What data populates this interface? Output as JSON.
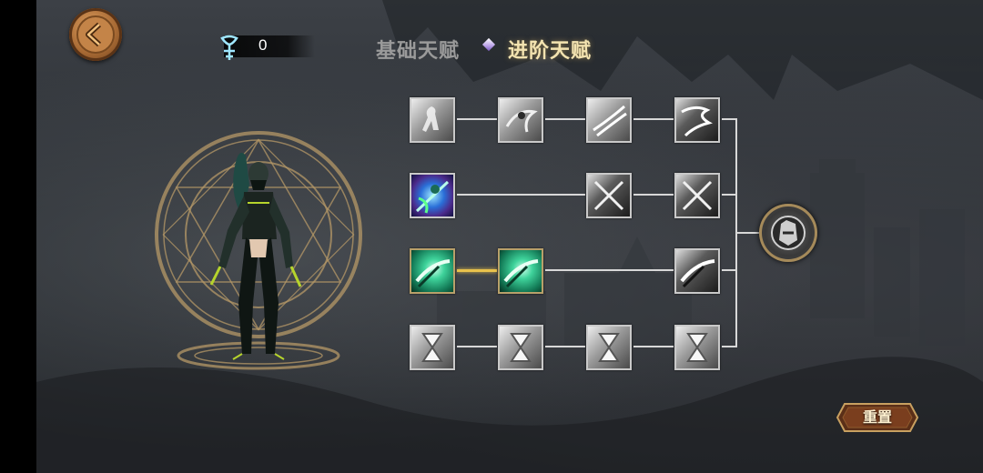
{
  "header": {
    "currency_value": "0",
    "currency_icon": "ankh-rune-icon"
  },
  "tabs": [
    {
      "label": "基础天赋",
      "active": false
    },
    {
      "label": "进阶天赋",
      "active": true
    }
  ],
  "talent_tree": {
    "rows": [
      {
        "nodes": [
          "pose-silhouette-icon",
          "dash-swirl-icon",
          "wind-slash-icon",
          "smoke-dash-icon"
        ]
      },
      {
        "nodes": [
          "blue-blade-skill-icon",
          "crossed-blades-icon",
          "crossed-blades-icon"
        ]
      },
      {
        "nodes": [
          "green-slash-icon",
          "green-slash-icon",
          "grey-slash-icon"
        ]
      },
      {
        "nodes": [
          "hourglass-icon",
          "hourglass-icon",
          "hourglass-icon",
          "hourglass-icon"
        ]
      }
    ],
    "final_node": "hero-portrait-icon",
    "active_link_color": "#e9c24c"
  },
  "buttons": {
    "reset_label": "重置"
  },
  "colors": {
    "active_tab": "#f3e3b0",
    "inactive_tab": "#9a9a9a",
    "gold_accent": "#c8a060"
  }
}
